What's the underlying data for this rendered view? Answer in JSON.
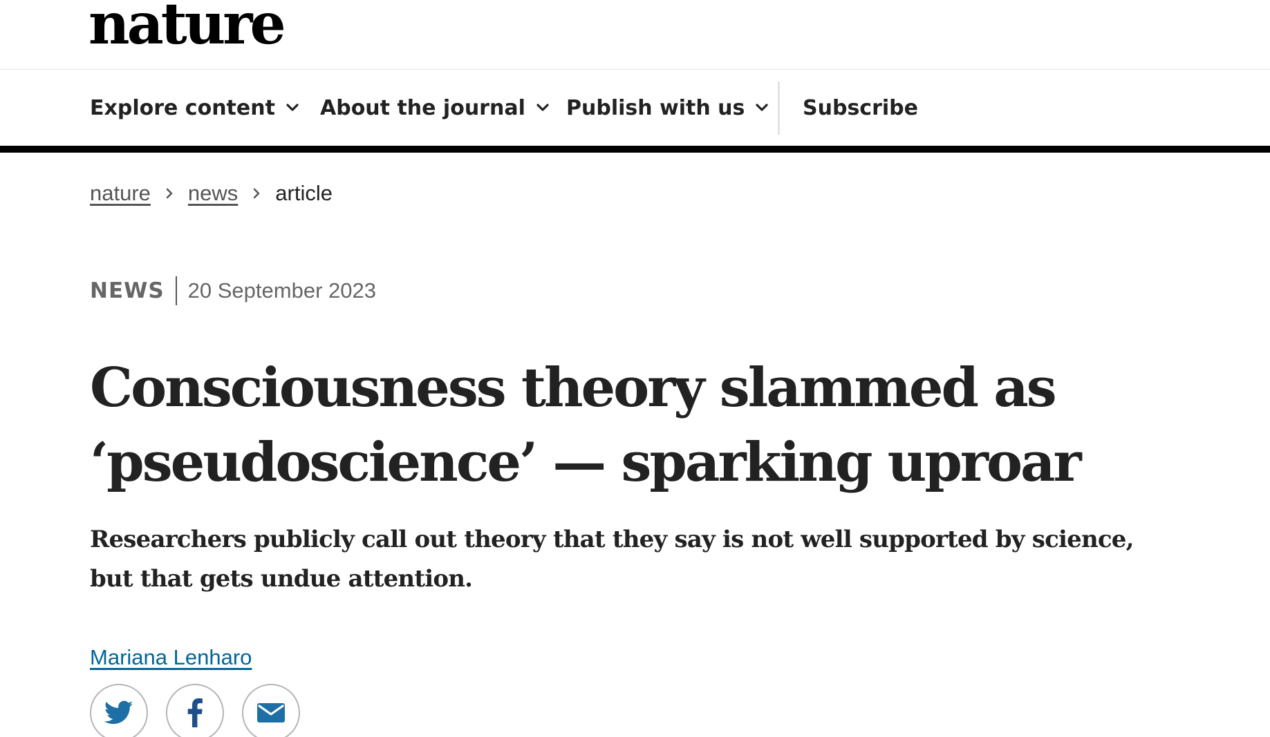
{
  "masthead": {
    "logo_text": "nature"
  },
  "nav": {
    "items": [
      {
        "label": "Explore content",
        "icon": "chevron-down-icon"
      },
      {
        "label": "About the journal",
        "icon": "chevron-down-icon"
      },
      {
        "label": "Publish with us",
        "icon": "chevron-down-icon"
      }
    ],
    "subscribe_label": "Subscribe"
  },
  "breadcrumb": {
    "items": [
      "nature",
      "news"
    ],
    "current": "article",
    "separator_icon": "chevron-right-icon"
  },
  "article": {
    "type": "NEWS",
    "date": "20 September 2023",
    "title": "Consciousness theory slammed as ‘pseudoscience’ — sparking uproar",
    "standfirst": "Researchers publicly call out theory that they say is not well supported by science, but that gets undue attention.",
    "author": "Mariana Lenharo"
  },
  "share": {
    "buttons": [
      {
        "icon": "twitter-icon"
      },
      {
        "icon": "facebook-icon"
      },
      {
        "icon": "email-icon"
      }
    ]
  },
  "colors": {
    "text": "#222222",
    "link_blue": "#006699",
    "twitter_blue": "#1d6fa5",
    "facebook_blue": "#1e4f8a",
    "email_blue": "#1d6fa5",
    "nav_rule": "#000000"
  }
}
